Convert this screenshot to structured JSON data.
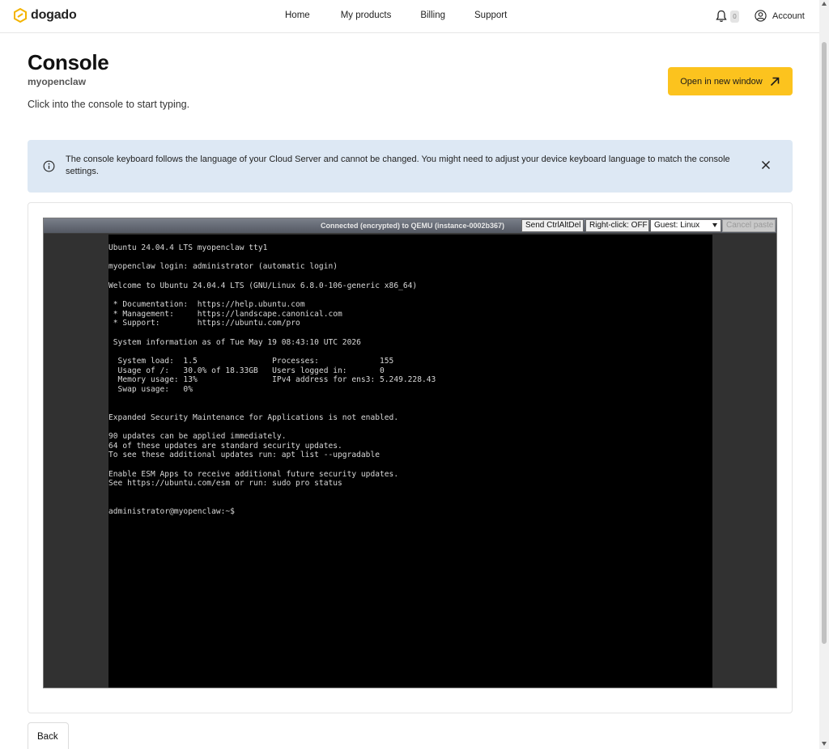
{
  "header": {
    "brand": "dogado",
    "nav": [
      "Home",
      "My products",
      "Billing",
      "Support"
    ],
    "notification_count": "0",
    "account_label": "Account"
  },
  "page": {
    "title": "Console",
    "subtitle": "myopenclaw",
    "hint": "Click into the console to start typing.",
    "open_button": "Open in new window"
  },
  "alert": {
    "text": "The console keyboard follows the language of your Cloud Server and cannot be changed. You might need to adjust your device keyboard language to match the console settings."
  },
  "vnc": {
    "status": "Connected (encrypted) to QEMU (instance-0002b367)",
    "send_ctrl_alt_del": "Send CtrlAltDel",
    "right_click": "Right-click: OFF",
    "guest_select": "Guest: Linux",
    "cancel_paste": "Cancel paste"
  },
  "terminal": {
    "lines": [
      "Ubuntu 24.04.4 LTS myopenclaw tty1",
      "",
      "myopenclaw login: administrator (automatic login)",
      "",
      "Welcome to Ubuntu 24.04.4 LTS (GNU/Linux 6.8.0-106-generic x86_64)",
      "",
      " * Documentation:  https://help.ubuntu.com",
      " * Management:     https://landscape.canonical.com",
      " * Support:        https://ubuntu.com/pro",
      "",
      " System information as of Tue May 19 08:43:10 UTC 2026",
      "",
      "  System load:  1.5                Processes:             155",
      "  Usage of /:   30.0% of 18.33GB   Users logged in:       0",
      "  Memory usage: 13%                IPv4 address for ens3: 5.249.228.43",
      "  Swap usage:   0%",
      "",
      "",
      "Expanded Security Maintenance for Applications is not enabled.",
      "",
      "90 updates can be applied immediately.",
      "64 of these updates are standard security updates.",
      "To see these additional updates run: apt list --upgradable",
      "",
      "Enable ESM Apps to receive additional future security updates.",
      "See https://ubuntu.com/esm or run: sudo pro status",
      "",
      "",
      "administrator@myopenclaw:~$"
    ]
  },
  "footer": {
    "back_button": "Back"
  },
  "colors": {
    "accent": "#fcc31e",
    "alert_bg": "#dde8f4",
    "terminal_bg": "#000000"
  }
}
